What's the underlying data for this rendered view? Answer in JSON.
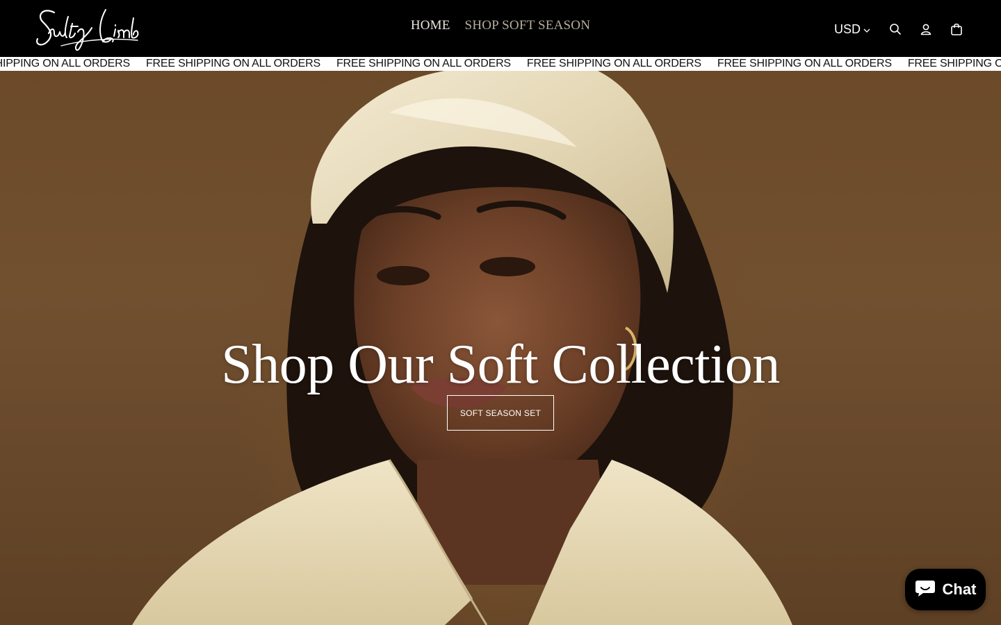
{
  "header": {
    "logo_text": "Sultry Limb",
    "nav": [
      {
        "label": "HOME"
      },
      {
        "label": "SHOP SOFT SEASON"
      }
    ],
    "currency": "USD",
    "icons": [
      "search-icon",
      "account-icon",
      "cart-icon",
      "chevron-down-icon"
    ]
  },
  "announcement": {
    "items": [
      "FREE SHIPPING ON ALL ORDERS",
      "FREE SHIPPING ON ALL ORDERS",
      "FREE SHIPPING ON ALL ORDERS",
      "FREE SHIPPING ON ALL ORDERS",
      "FREE SHIPPING ON ALL ORDERS",
      "FREE SHIPPING ON ALL ORDERS"
    ]
  },
  "hero": {
    "title": "Shop Our Soft Collection",
    "cta_label": "SOFT SEASON SET"
  },
  "chat": {
    "label": "Chat",
    "icon": "chat-bubble-icon"
  },
  "colors": {
    "header_bg": "#000000",
    "marquee_bg": "#ffffff",
    "hero_bg": "#6f4d2b",
    "nav_active": "#e9e6df",
    "nav_muted": "#b7ada0"
  }
}
